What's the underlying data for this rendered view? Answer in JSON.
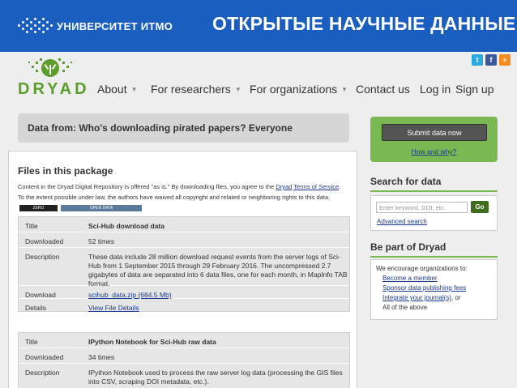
{
  "banner": {
    "org_name": "УНИВЕРСИТЕТ ИТМО",
    "title": "ОТКРЫТЫЕ НАУЧНЫЕ ДАННЫЕ",
    "color": "#1a5ec0"
  },
  "site": {
    "logo_text": "DRYAD",
    "social": [
      {
        "icon": "twitter-icon",
        "glyph": "t"
      },
      {
        "icon": "facebook-icon",
        "glyph": "f"
      },
      {
        "icon": "rss-icon",
        "glyph": "⌁"
      }
    ],
    "nav": {
      "about": "About",
      "researchers": "For researchers",
      "organizations": "For organizations",
      "contact": "Contact us",
      "login": "Log in",
      "signup": "Sign up"
    },
    "data_from": "Data from: Who's downloading pirated papers? Everyone",
    "submit": {
      "button": "Submit data now",
      "how_why": "How and why?"
    },
    "search": {
      "heading": "Search for data",
      "placeholder": "Enter keyword, DOI, etc.",
      "go": "Go",
      "advanced": "Advanced search"
    },
    "member": {
      "heading": "Be part of Dryad",
      "intro": "We encourage organizations to:",
      "item1": "Become a member",
      "item2": "Sponsor data publishing fees",
      "item3": "Integrate your journal(s)",
      "item3_suffix": ", or",
      "item4": "All of the above"
    },
    "files": {
      "heading": "Files in this package",
      "disclaimer_1": "Content in the Dryad Digital Repository is offered \"as is.\" By downloading files, you agree to the",
      "disclaimer_link1": "Dryad",
      "disclaimer_link2": "Terms of Service",
      "disclaimer_2": ". To the extent possible under law, the authors have waived all copyright and related or neighboring rights to this data.",
      "cc_badge": "ZERO",
      "od_badge": "OPEN DATA",
      "table1": {
        "title_label": "Title",
        "title_value": "Sci-Hub download data",
        "downloaded_label": "Downloaded",
        "downloaded_value": "52 times",
        "description_label": "Description",
        "description_value": "These data include 28 million download request events from the server logs of Sci-Hub from 1 September 2015 through 29 February 2016. The uncompressed 2.7 gigabytes of data are separated into 6 data files, one for each month, in MapInfo TAB format.",
        "download_label": "Download",
        "download_value": "scihub_data.zip (684.5 Mb)",
        "details_label": "Details",
        "details_value": "View File Details"
      },
      "table2": {
        "title_label": "Title",
        "title_value": "IPython Notebook for Sci-Hub raw data",
        "downloaded_label": "Downloaded",
        "downloaded_value": "34 times",
        "description_label": "Description",
        "description_value": "IPython Notebook used to process the raw server log data (processing the GIS files into CSV, scraping DOI metadata, etc.)."
      }
    },
    "colors": {
      "green": "#7ab951",
      "dark_green": "#3e6e1d",
      "link": "#1a3a8a"
    }
  }
}
